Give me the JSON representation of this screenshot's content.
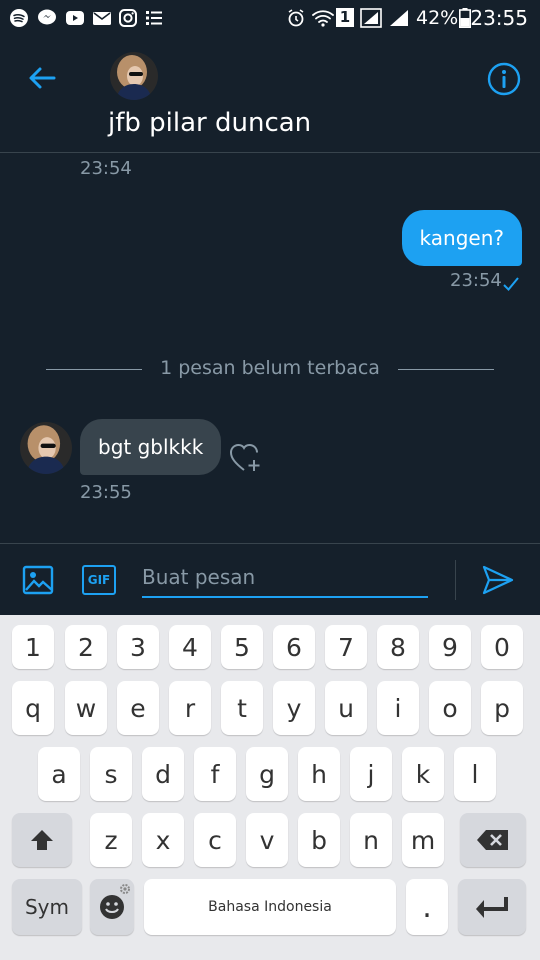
{
  "status_bar": {
    "battery_percent": "42%",
    "time": "23:55",
    "sim_slot": "1",
    "icons": [
      "spotify-icon",
      "messenger-icon",
      "youtube-icon",
      "mail-icon",
      "instagram-icon",
      "list-icon",
      "alarm-icon",
      "wifi-icon",
      "sim-icon",
      "signal-icon",
      "battery-icon"
    ]
  },
  "header": {
    "contact_name": "jfb pilar duncan",
    "icons": [
      "back-arrow-icon",
      "info-icon"
    ]
  },
  "conversation": {
    "messages": [
      {
        "direction": "in",
        "time": "23:54"
      },
      {
        "direction": "out",
        "text": "kangen?",
        "time": "23:54",
        "status": "sent"
      },
      {
        "direction": "in",
        "text": "bgt gblkkk",
        "time": "23:55"
      }
    ],
    "unread_divider": "1 pesan belum terbaca"
  },
  "composer": {
    "placeholder": "Buat pesan",
    "value": "",
    "gif_label": "GIF"
  },
  "keyboard": {
    "row1": [
      "1",
      "2",
      "3",
      "4",
      "5",
      "6",
      "7",
      "8",
      "9",
      "0"
    ],
    "row2": [
      "q",
      "w",
      "e",
      "r",
      "t",
      "y",
      "u",
      "i",
      "o",
      "p"
    ],
    "row3": [
      "a",
      "s",
      "d",
      "f",
      "g",
      "h",
      "j",
      "k",
      "l"
    ],
    "row4": [
      "z",
      "x",
      "c",
      "v",
      "b",
      "n",
      "m"
    ],
    "sym_label": "Sym",
    "space_label": "Bahasa Indonesia",
    "period_label": "."
  },
  "colors": {
    "background": "#15202b",
    "accent": "#1da1f2",
    "incoming_bubble": "#38444d",
    "muted_text": "#8899a6",
    "keyboard_bg": "#e8e9ec"
  }
}
